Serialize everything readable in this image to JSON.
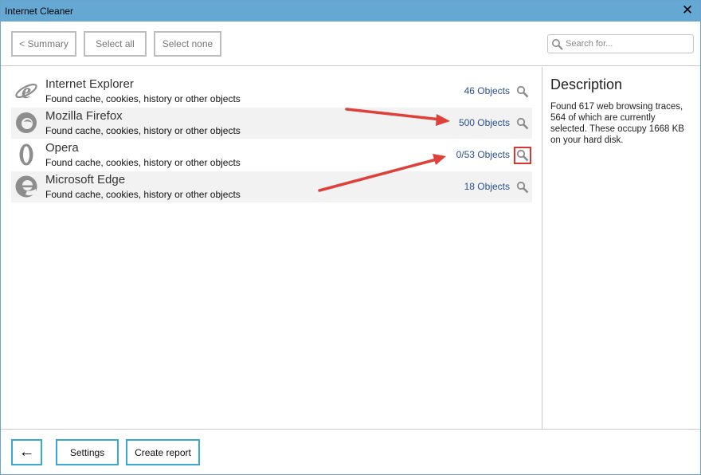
{
  "window": {
    "title": "Internet Cleaner",
    "close_glyph": "✕"
  },
  "toolbar": {
    "summary_label": "< Summary",
    "select_all_label": "Select all",
    "select_none_label": "Select none",
    "search_placeholder": "Search for..."
  },
  "browsers": [
    {
      "name": "Internet Explorer",
      "desc": "Found cache, cookies, history or other objects",
      "count": "46 Objects",
      "icon": "internet-explorer-icon"
    },
    {
      "name": "Mozilla Firefox",
      "desc": "Found cache, cookies, history or other objects",
      "count": "500 Objects",
      "icon": "firefox-icon"
    },
    {
      "name": "Opera",
      "desc": "Found cache, cookies, history or other objects",
      "count": "0/53 Objects",
      "icon": "opera-icon"
    },
    {
      "name": "Microsoft Edge",
      "desc": "Found cache, cookies, history or other objects",
      "count": "18 Objects",
      "icon": "edge-icon"
    }
  ],
  "description": {
    "title": "Description",
    "text": "Found 617 web browsing traces, 564 of which are currently selected. These occupy 1668 KB on your hard disk."
  },
  "footer": {
    "back_glyph": "←",
    "settings_label": "Settings",
    "create_report_label": "Create report"
  },
  "colors": {
    "titlebar": "#66a8d4",
    "accent_border": "#3aa7cf",
    "link": "#2a4f8f",
    "annotation_arrow": "#e0403a"
  }
}
